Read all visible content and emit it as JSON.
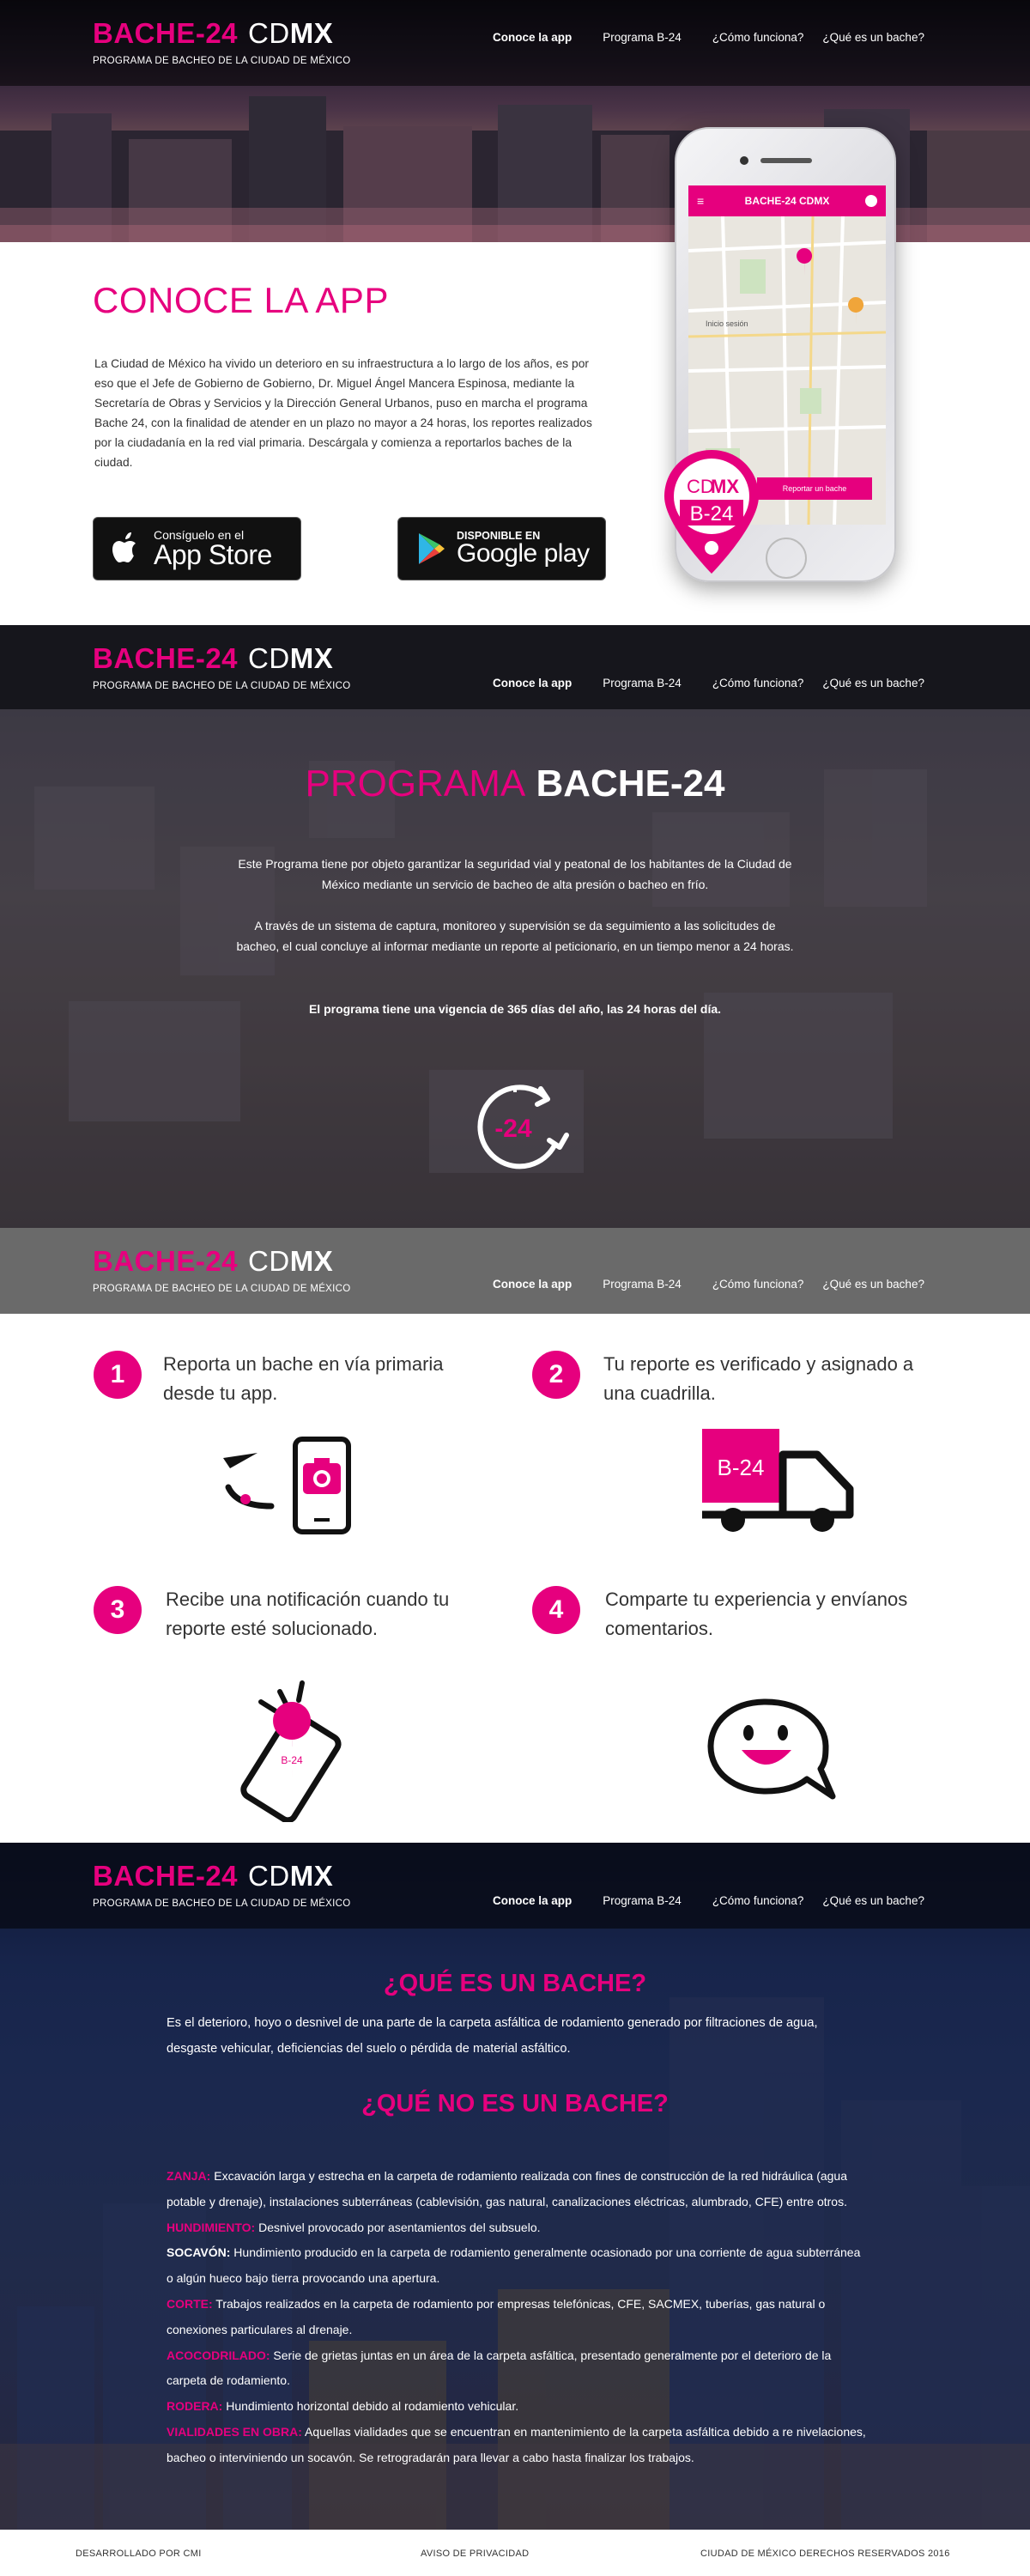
{
  "brand": {
    "main": "BACHE-24",
    "cd": "CD",
    "mx": "MX",
    "subtitle": "PROGRAMA DE BACHEO DE LA CIUDAD DE MÉXICO"
  },
  "nav": [
    "Conoce la app",
    "Programa B-24",
    "¿Cómo funciona?",
    "¿Qué es un bache?"
  ],
  "app": {
    "title": "CONOCE LA APP",
    "text": "La Ciudad de México ha vivido un deterioro en su infraestructura a lo largo de los años, es por eso que el Jefe de Gobierno de Gobierno, Dr. Miguel Ángel Mancera Espinosa, mediante la Secretaría de Obras y Servicios y la Dirección General Urbanos, puso en marcha el programa Bache 24, con la finalidad de atender en un plazo no mayor a 24 horas, los reportes realizados por la ciudadanía en la red vial primaria. Descárgala y comienza a reportarlos baches de la ciudad.",
    "apple_small": "Consíguelo en el",
    "apple_big": "App Store",
    "google_small": "DISPONIBLE EN",
    "google_big": "Google play",
    "phone_title": "BACHE-24 CDMX",
    "phone_button": "Reportar un bache",
    "pin_cd": "CD",
    "pin_mx": "MX",
    "pin_b24": "B-24"
  },
  "programa": {
    "title_a": "PROGRAMA",
    "title_b": "BACHE-24",
    "p1": "Este Programa tiene por objeto garantizar la seguridad vial y peatonal de los habitantes de la Ciudad de México mediante un servicio de bacheo de alta presión o bacheo en frío.",
    "p2": "A través de un sistema de captura, monitoreo y supervisión se da seguimiento a las solicitudes de bacheo, el cual concluye al informar mediante un reporte al peticionario, en un tiempo menor a 24 horas.",
    "p3": "El programa tiene una vigencia de 365 días del año, las 24 horas del día.",
    "clock_label": "-24"
  },
  "steps": [
    {
      "num": "1",
      "text": "Reporta un bache en vía primaria desde tu app."
    },
    {
      "num": "2",
      "text": "Tu reporte es verificado y asignado a una cuadrilla."
    },
    {
      "num": "3",
      "text": "Recibe una notificación cuando tu reporte esté solucionado."
    },
    {
      "num": "4",
      "text": "Comparte tu experiencia y envíanos comentarios."
    }
  ],
  "truck_label": "B-24",
  "que": {
    "title1": "¿QUÉ ES UN BACHE?",
    "p1": "Es el deterioro, hoyo o desnivel de una parte de la carpeta asfáltica de rodamiento generado por filtraciones de agua, desgaste vehicular, deficiencias del suelo o pérdida de material asfáltico.",
    "title2": "¿QUÉ NO ES UN BACHE?",
    "defs": [
      {
        "term": "ZANJA:",
        "text": " Excavación larga y estrecha en la carpeta de rodamiento realizada con fines de construcción de la red hidráulica (agua potable y drenaje), instalaciones subterráneas (cablevisión, gas natural, canalizaciones eléctricas, alumbrado, CFE) entre otros.",
        "pink": true
      },
      {
        "term": "HUNDIMIENTO:",
        "text": " Desnivel provocado por asentamientos del subsuelo.",
        "pink": true
      },
      {
        "term": "SOCAVÓN:",
        "text": " Hundimiento producido en la carpeta de rodamiento generalmente ocasionado por una corriente de agua subterránea o algún hueco bajo tierra provocando una apertura.",
        "pink": false
      },
      {
        "term": "CORTE:",
        "text": " Trabajos realizados en la carpeta de rodamiento por empresas telefónicas, CFE, SACMEX, tuberías, gas natural o conexiones particulares al drenaje.",
        "pink": true
      },
      {
        "term": "ACOCODRILADO:",
        "text": " Serie de grietas juntas en un área de la carpeta asfáltica, presentado generalmente por el deterioro de la carpeta de rodamiento.",
        "pink": true
      },
      {
        "term": "RODERA:",
        "text": " Hundimiento horizontal debido al rodamiento vehicular.",
        "pink": true
      },
      {
        "term": "VIALIDADES EN OBRA:",
        "text": " Aquellas vialidades que se encuentran en mantenimiento de la carpeta asfáltica debido a re nivelaciones, bacheo o interviniendo un socavón. Se retrogradarán para llevar a cabo hasta finalizar los trabajos.",
        "pink": true
      }
    ]
  },
  "footer": {
    "left": "DESARROLLADO POR CMI",
    "center": "AVISO DE PRIVACIDAD",
    "right": "CIUDAD DE MÉXICO DERECHOS RESERVADOS 2016"
  }
}
